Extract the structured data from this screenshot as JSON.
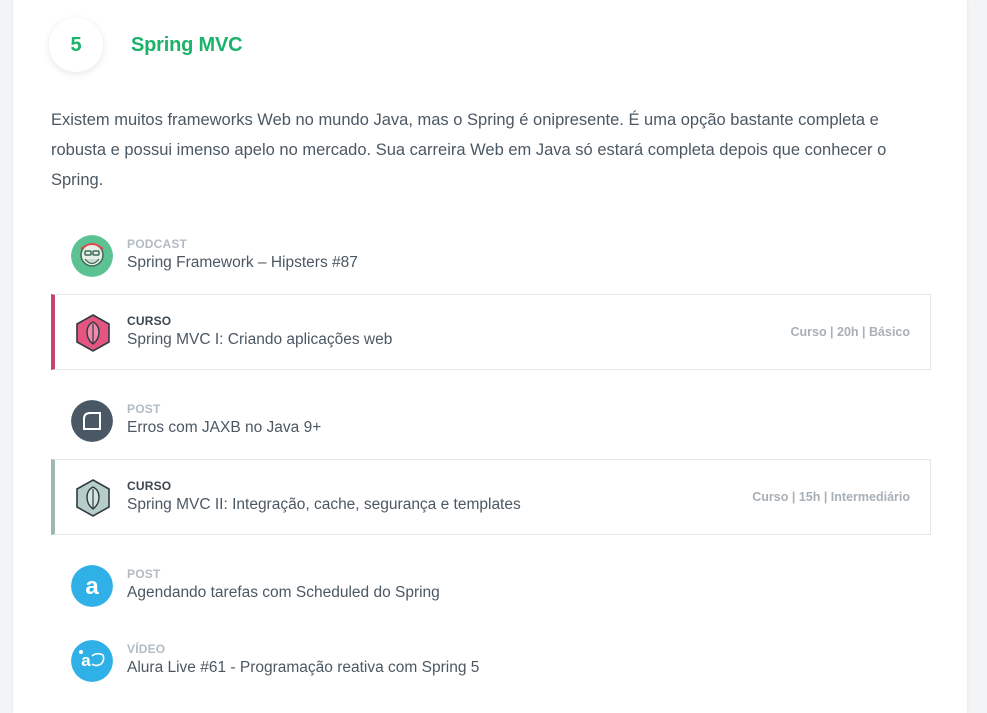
{
  "step": {
    "number": "5",
    "title": "Spring MVC",
    "description": "Existem muitos frameworks Web no mundo Java, mas o Spring é onipresente. É uma opção bastante completa e robusta e possui imenso apelo no mercado. Sua carreira Web em Java só estará completa depois que conhecer o Spring."
  },
  "colors": {
    "accent": "#1bb36a",
    "course_1": "#c8436f",
    "course_2": "#9fb8b3",
    "post_blue": "#2fb1e8"
  },
  "items": [
    {
      "kind": "PODCAST",
      "name": "Spring Framework – Hipsters #87",
      "meta": "",
      "icon": "hipsters-podcast-icon"
    },
    {
      "kind": "CURSO",
      "name": "Spring MVC I: Criando aplicações web",
      "meta": "Curso | 20h | Básico",
      "icon": "spring-course-icon"
    },
    {
      "kind": "POST",
      "name": "Erros com JAXB no Java 9+",
      "meta": "",
      "icon": "post-icon"
    },
    {
      "kind": "CURSO",
      "name": "Spring MVC II: Integração, cache, segurança e templates",
      "meta": "Curso | 15h | Intermediário",
      "icon": "spring-course-icon"
    },
    {
      "kind": "POST",
      "name": "Agendando tarefas com Scheduled do Spring",
      "meta": "",
      "icon": "alura-post-icon"
    },
    {
      "kind": "VÍDEO",
      "name": "Alura Live #61 - Programação reativa com Spring 5",
      "meta": "",
      "icon": "alura-live-icon"
    }
  ]
}
